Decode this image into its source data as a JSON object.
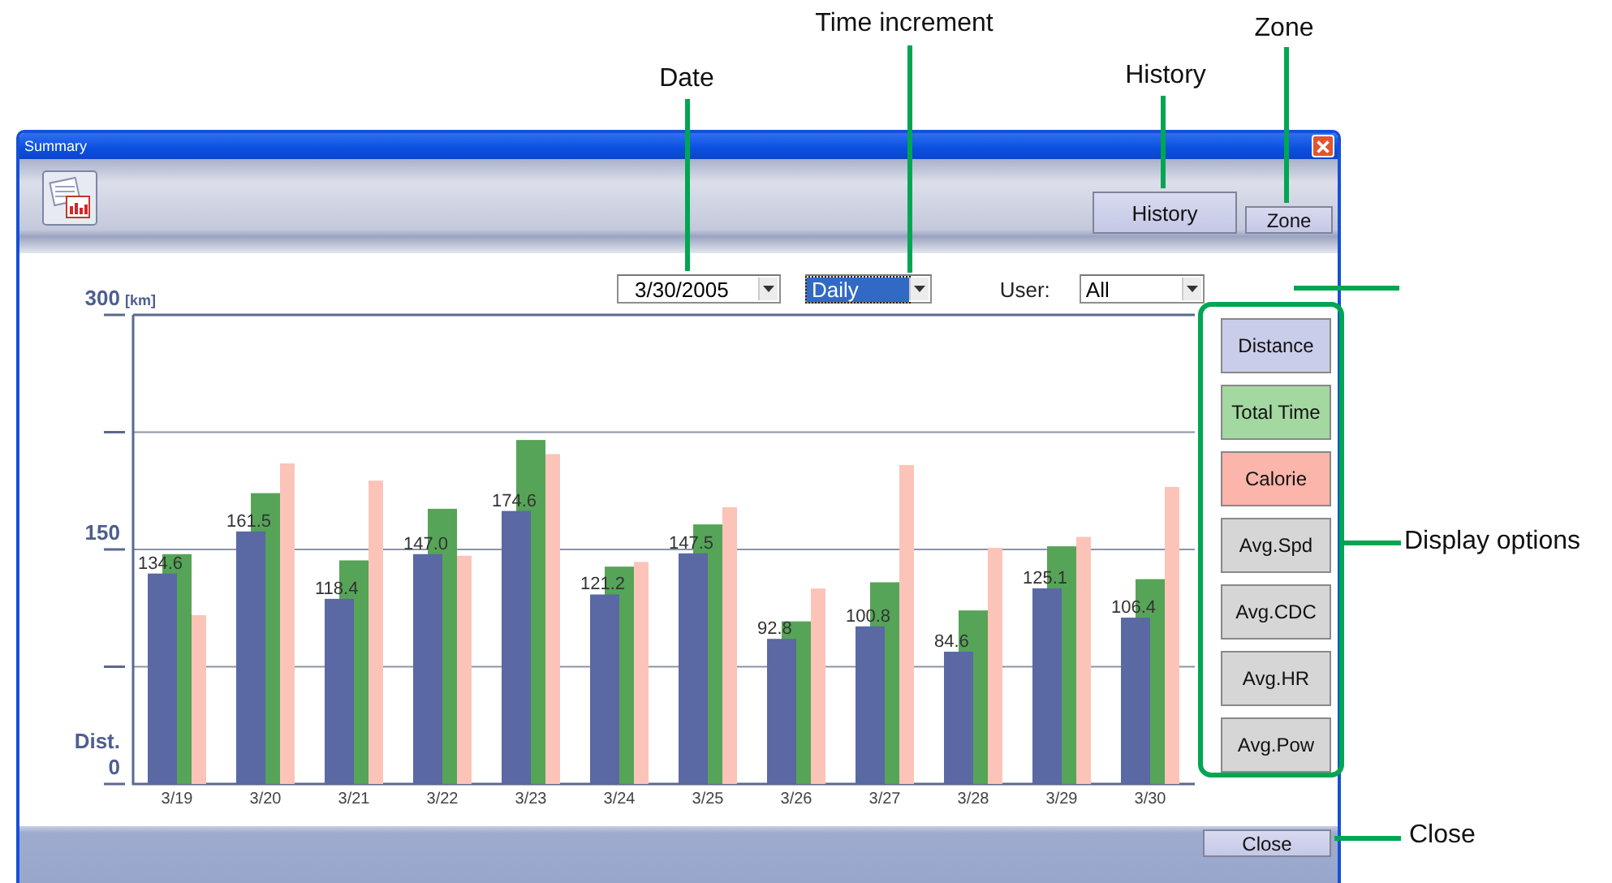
{
  "window": {
    "title": "Summary"
  },
  "toolbar": {
    "buttons": [
      {
        "label": "History",
        "kind": "large"
      },
      {
        "label": "Zone",
        "kind": "small"
      }
    ]
  },
  "filters": {
    "date": {
      "value": "3/30/2005"
    },
    "increment": {
      "value": "Daily",
      "highlighted": true
    },
    "user": {
      "label": "User:",
      "value": "All"
    }
  },
  "chart": {
    "axis_labels": {
      "unit": "[km]"
    },
    "chart_data": {
      "type": "bar",
      "categories": [
        "3/19",
        "3/20",
        "3/21",
        "3/22",
        "3/23",
        "3/24",
        "3/25",
        "3/26",
        "3/27",
        "3/28",
        "3/29",
        "3/30"
      ],
      "yticks": [
        0,
        150,
        300
      ],
      "grid": true,
      "ylim": [
        0,
        300
      ],
      "ylabel": "Dist.",
      "series": [
        {
          "color": "#5a68a4",
          "values": [
            134.6,
            161.5,
            118.4,
            147.0,
            174.6,
            121.2,
            147.5,
            92.8,
            100.8,
            84.6,
            125.1,
            106.4
          ],
          "value_labels": [
            "134.6",
            "161.5",
            "118.4",
            "147.0",
            "174.6",
            "121.2",
            "147.5",
            "92.8",
            "100.8",
            "84.6",
            "125.1",
            "106.4"
          ]
        },
        {
          "color": "#56a457",
          "values": [
            147,
            186,
            143,
            176,
            220,
            139,
            166,
            104,
            129,
            111,
            152,
            131
          ]
        },
        {
          "color": "#fcc4b8",
          "values": [
            108,
            205,
            194,
            146,
            211,
            142,
            177,
            125,
            204,
            151,
            158,
            190
          ]
        }
      ]
    }
  },
  "display_options": [
    {
      "label": "Distance",
      "color": "#c9cde9"
    },
    {
      "label": "Total Time",
      "color": "#a3d8a0"
    },
    {
      "label": "Calorie",
      "color": "#fbb5aa"
    },
    {
      "label": "Avg.Spd",
      "color": "#d6d6d6"
    },
    {
      "label": "Avg.CDC",
      "color": "#d6d6d6"
    },
    {
      "label": "Avg.HR",
      "color": "#d6d6d6"
    },
    {
      "label": "Avg.Pow",
      "color": "#d6d6d6"
    }
  ],
  "footer": {
    "close_button": "Close"
  },
  "callouts": [
    {
      "label": "Date",
      "kind": "top"
    },
    {
      "label": "Time increment",
      "kind": "top"
    },
    {
      "label": "History",
      "kind": "top"
    },
    {
      "label": "Zone",
      "kind": "top"
    },
    {
      "label": "Display options",
      "kind": "side"
    },
    {
      "label": "Close",
      "kind": "side"
    }
  ]
}
